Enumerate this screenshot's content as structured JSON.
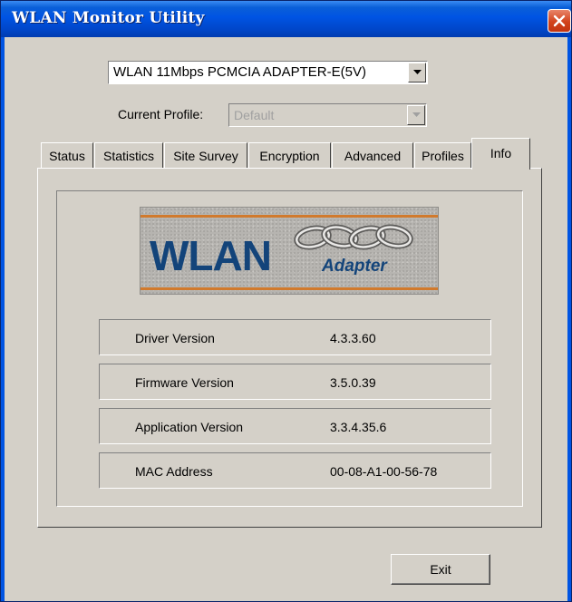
{
  "window": {
    "title": "WLAN Monitor Utility"
  },
  "adapter_select": {
    "value": "WLAN 11Mbps PCMCIA ADAPTER-E(5V)"
  },
  "profile": {
    "label": "Current Profile:",
    "value": "Default"
  },
  "tabs": [
    {
      "label": "Status",
      "active": false
    },
    {
      "label": "Statistics",
      "active": false
    },
    {
      "label": "Site Survey",
      "active": false
    },
    {
      "label": "Encryption",
      "active": false
    },
    {
      "label": "Advanced",
      "active": false
    },
    {
      "label": "Profiles",
      "active": false
    },
    {
      "label": "Info",
      "active": true
    }
  ],
  "logo": {
    "title": "WLAN",
    "subtitle": "Adapter"
  },
  "info": [
    {
      "label": "Driver Version",
      "value": "4.3.3.60"
    },
    {
      "label": "Firmware Version",
      "value": "3.5.0.39"
    },
    {
      "label": "Application Version",
      "value": "3.3.4.35.6"
    },
    {
      "label": "MAC Address",
      "value": "00-08-A1-00-56-78"
    }
  ],
  "buttons": {
    "exit": "Exit"
  },
  "colors": {
    "titlebar": "#0054e3",
    "dialog_face": "#d4d0c8",
    "close_button": "#d2431c",
    "logo_text": "#13447a",
    "logo_stripe": "#d17a2d"
  }
}
